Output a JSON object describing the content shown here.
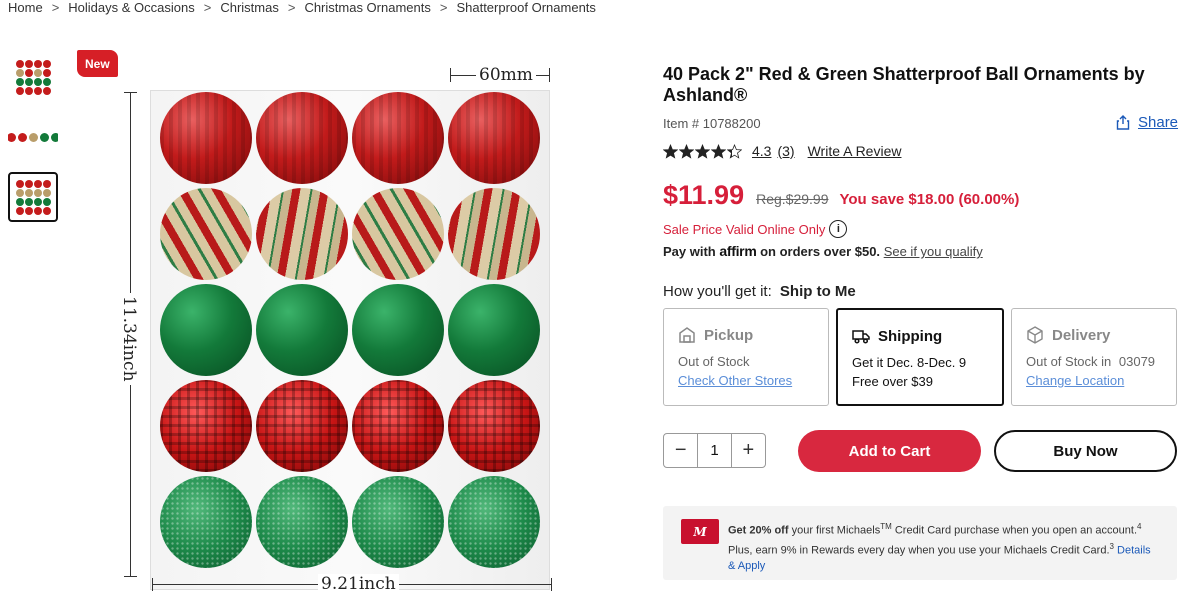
{
  "breadcrumb": [
    "Home",
    "Holidays & Occasions",
    "Christmas",
    "Christmas Ornaments",
    "Shatterproof Ornaments"
  ],
  "badge": "New",
  "dimensions": {
    "width": "60mm",
    "height": "11.34inch",
    "base": "9.21inch"
  },
  "product": {
    "title": "40 Pack 2\" Red & Green Shatterproof Ball Ornaments by Ashland®",
    "item_number": "Item # 10788200",
    "share": "Share",
    "rating": "4.3",
    "rating_value": 4.3,
    "review_count": "(3)",
    "write_review": "Write A Review"
  },
  "pricing": {
    "sale": "$11.99",
    "regular": "Reg.$29.99",
    "savings": "You save $18.00 (60.00%)",
    "sale_valid": "Sale Price Valid Online Only",
    "affirm_prefix": "Pay with",
    "affirm_logo": "affirm",
    "affirm_suffix": "on orders over $50.",
    "affirm_link": "See if you qualify"
  },
  "fulfillment": {
    "label": "How you'll get it:",
    "selected": "Ship to Me",
    "options": [
      {
        "title": "Pickup",
        "line1": "Out of Stock",
        "link": "Check Other Stores"
      },
      {
        "title": "Shipping",
        "line1": "Get it Dec. 8-Dec. 9",
        "line2": "Free over $39"
      },
      {
        "title": "Delivery",
        "line1": "Out of Stock in",
        "zip": "03079",
        "link": "Change Location"
      }
    ]
  },
  "cart": {
    "quantity": "1",
    "minus": "−",
    "plus": "+",
    "add_to_cart": "Add to Cart",
    "buy_now": "Buy Now"
  },
  "credit": {
    "card_logo": "M",
    "bold": "Get 20% off",
    "text1": "your first Michaels",
    "tm": "TM",
    "text2": "Credit Card purchase when you open an account.",
    "sup1": "4",
    "text3": "Plus, earn 9% in Rewards every day when you use your Michaels Credit Card.",
    "sup2": "3",
    "link": "Details & Apply"
  },
  "colors": {
    "accent_red": "#d61f3a",
    "link_blue": "#1b59b8"
  }
}
